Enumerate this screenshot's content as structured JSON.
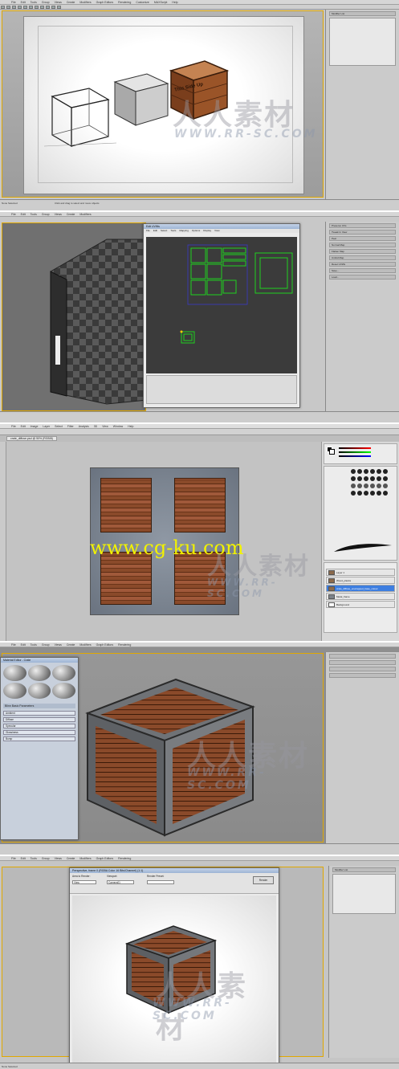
{
  "menu": [
    "File",
    "Edit",
    "Tools",
    "Group",
    "Views",
    "Create",
    "Modifiers",
    "Graph Editors",
    "Rendering",
    "Customize",
    "MAXScript",
    "Help"
  ],
  "panel1": {
    "status_left": "None Selected",
    "status_right": "Click and drag to select and move objects",
    "modifier_list": "Modifier List",
    "crate_text": "This Side Up"
  },
  "panel2": {
    "dialog_title": "Edit UVWs",
    "dialog_menu": [
      "File",
      "Edit",
      "Select",
      "Tools",
      "Mapping",
      "Options",
      "Display",
      "View"
    ],
    "right_items": [
      "Preserve UVs",
      "Tweak In View",
      "Peel",
      "Normal Map",
      "Flatten Map",
      "Unfold Map",
      "Reset UVWs",
      "Save...",
      "Load..."
    ]
  },
  "panel3": {
    "tab_label": "crate_diffuse.psd @ 50% (RGB/8)",
    "menu": [
      "File",
      "Edit",
      "Image",
      "Layer",
      "Select",
      "Filter",
      "Analysis",
      "3D",
      "View",
      "Window",
      "Help"
    ],
    "watermark": "www.cg-ku.com",
    "layers": [
      "Layer 1",
      "Wood_planks",
      "crate_diffuse_unwrapped_base_colour",
      "Metal_frame",
      "Background"
    ]
  },
  "panel4": {
    "dialog_title": "Material Editor - Crate",
    "params_title": "Blinn Basic Parameters",
    "maps": [
      "Ambient",
      "Diffuse",
      "Specular",
      "Glossiness",
      "Bump"
    ]
  },
  "panel5": {
    "dialog_title": "Perspective, frame 0 (RGBA Color 16 Bits/Channel) (1:1)",
    "area_label": "Area to Render:",
    "area_value": "View",
    "viewport_label": "Viewport:",
    "viewport_value": "Camera01",
    "preset_label": "Render Preset:",
    "render_button": "Render",
    "status_left": "None Selected"
  },
  "watermarks": {
    "main": "人人素材",
    "sub": "WWW.RR-SC.COM"
  },
  "colors": {
    "viewport_border": "#e1a800",
    "uv_green": "#1fd01f",
    "ps_watermark": "#f2f200",
    "layer_selected": "#3d7ee0"
  }
}
